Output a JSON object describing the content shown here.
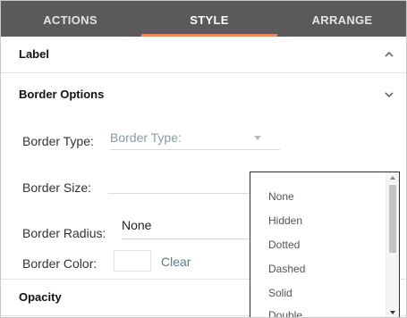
{
  "tabs": {
    "actions": "ACTIONS",
    "style": "STYLE",
    "arrange": "ARRANGE",
    "active": "STYLE"
  },
  "sections": {
    "label": {
      "title": "Label",
      "state": "collapsed",
      "icon": "chevron-up-icon"
    },
    "border_options": {
      "title": "Border Options",
      "state": "expanded",
      "icon": "chevron-down-icon"
    },
    "opacity": {
      "title": "Opacity"
    }
  },
  "border": {
    "type_label": "Border Type:",
    "type_placeholder": "Border Type:",
    "size_label": "Border Size:",
    "size_value": "",
    "radius_label": "Border Radius:",
    "radius_value": "None",
    "color_label": "Border Color:",
    "clear_label": "Clear"
  },
  "dropdown": {
    "options": [
      "None",
      "Hidden",
      "Dotted",
      "Dashed",
      "Solid",
      "Double"
    ]
  },
  "colors": {
    "tab_bar": "#5a5a5a",
    "accent": "#e98a5b",
    "link": "#5d7c8c",
    "placeholder": "#8a9aa6"
  }
}
